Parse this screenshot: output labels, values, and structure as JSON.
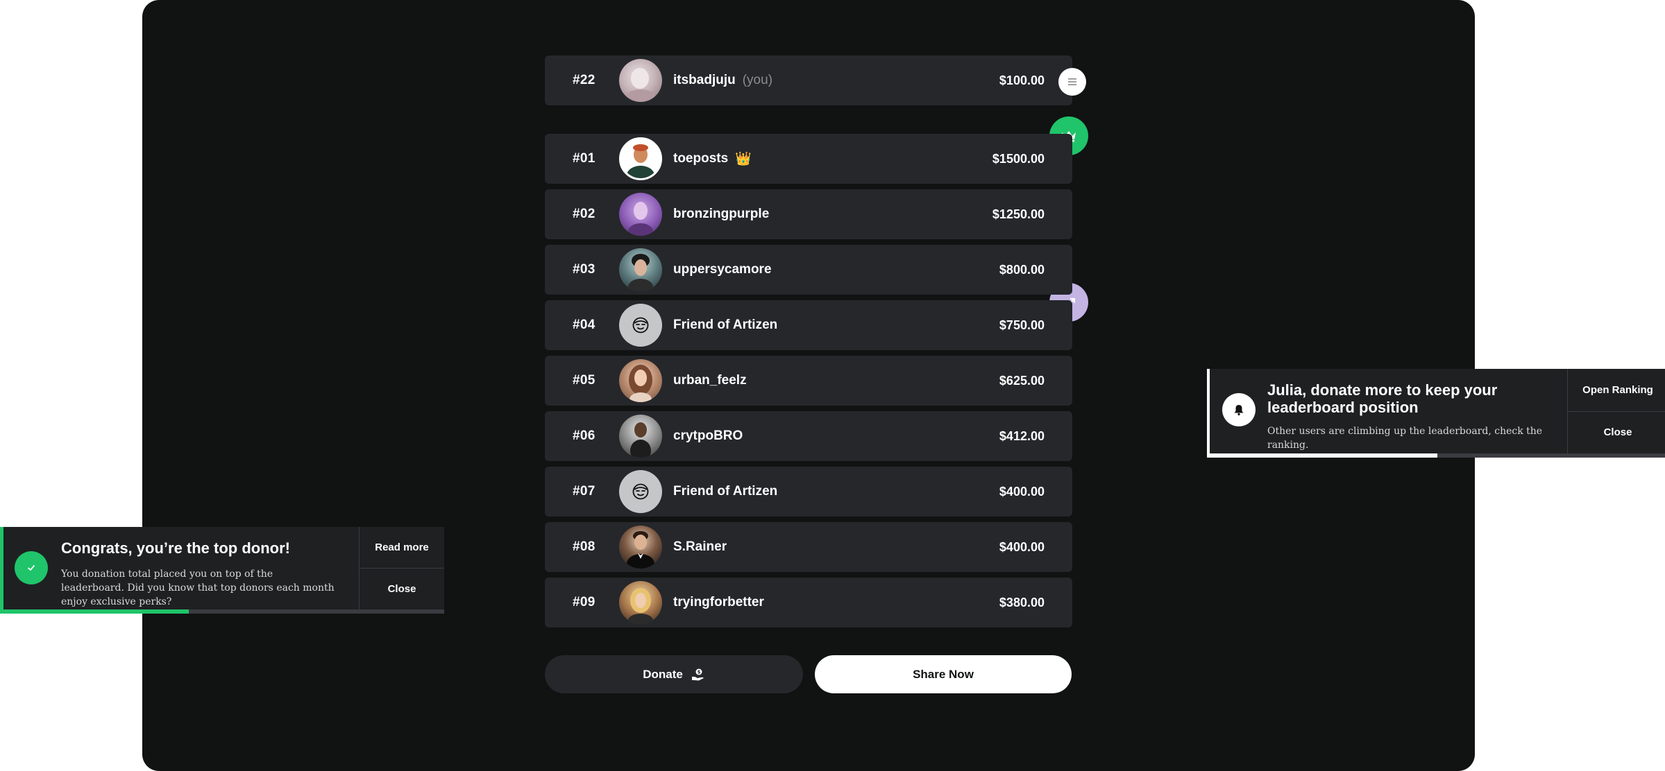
{
  "current_user": {
    "rank": "#22",
    "name": "itsbadjuju",
    "tag": "(you)",
    "amount": "$100.00"
  },
  "leaderboard": [
    {
      "rank": "#01",
      "name": "toeposts",
      "badge": "👑",
      "amount": "$1500.00",
      "avatar": "photo"
    },
    {
      "rank": "#02",
      "name": "bronzingpurple",
      "amount": "$1250.00",
      "avatar": "photo"
    },
    {
      "rank": "#03",
      "name": "uppersycamore",
      "amount": "$800.00",
      "avatar": "photo"
    },
    {
      "rank": "#04",
      "name": "Friend of Artizen",
      "amount": "$750.00",
      "avatar": "face-icon"
    },
    {
      "rank": "#05",
      "name": "urban_feelz",
      "amount": "$625.00",
      "avatar": "photo"
    },
    {
      "rank": "#06",
      "name": "crytpoBRO",
      "amount": "$412.00",
      "avatar": "photo"
    },
    {
      "rank": "#07",
      "name": "Friend of Artizen",
      "amount": "$400.00",
      "avatar": "face-icon"
    },
    {
      "rank": "#08",
      "name": "S.Rainer",
      "amount": "$400.00",
      "avatar": "photo"
    },
    {
      "rank": "#09",
      "name": "tryingforbetter",
      "amount": "$380.00",
      "avatar": "photo"
    }
  ],
  "actions": {
    "donate_label": "Donate",
    "share_label": "Share Now"
  },
  "toast_success": {
    "title": "Congrats, you’re the top donor!",
    "body": "You donation total placed you on top of the leaderboard. Did you know that top donors each month enjoy exclusive perks?",
    "primary_action": "Read more",
    "secondary_action": "Close",
    "progress": 0.42
  },
  "toast_alert": {
    "title": "Julia, donate more to keep your leaderboard position",
    "body": "Other users are climbing up the leaderboard, check the ranking.",
    "primary_action": "Open Ranking",
    "secondary_action": "Close",
    "progress": 0.5
  },
  "colors": {
    "accent_green": "#20c46a",
    "accent_purple": "#c3b4e4",
    "row_bg": "#25272b",
    "page_bg": "#111212"
  }
}
